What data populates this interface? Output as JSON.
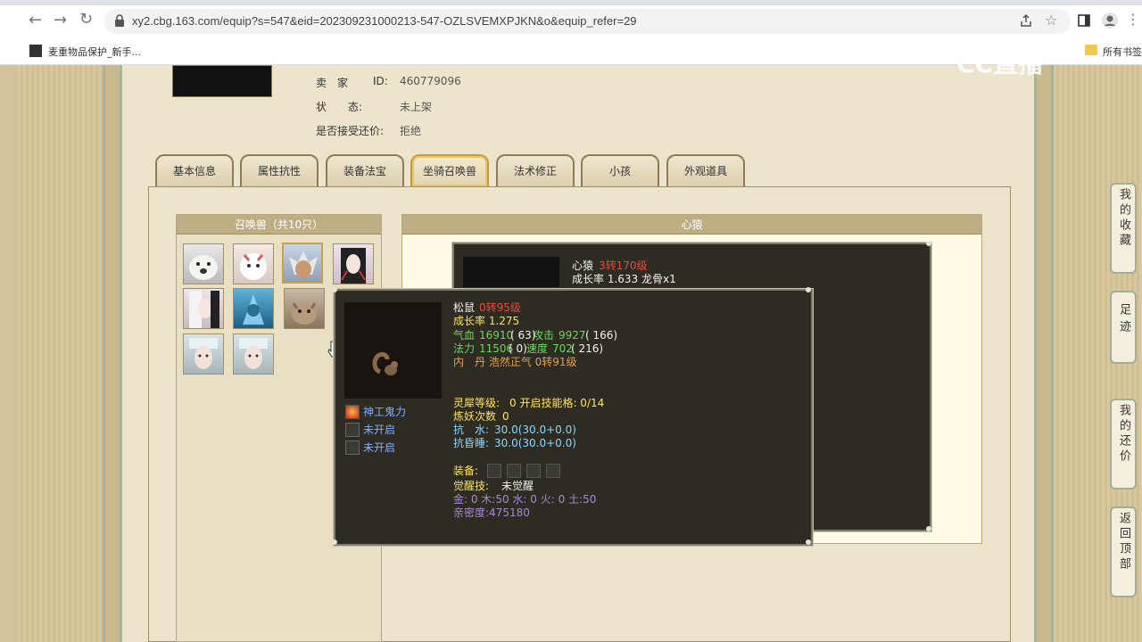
{
  "browser": {
    "url": "xy2.cbg.163.com/equip?s=547&eid=202309231000213-547-OZLSVEMXPJKN&o&equip_refer=29",
    "bookmark": "麦重物品保护_新手...",
    "all_bookmarks": "所有书签",
    "watermark": "CC直播"
  },
  "seller_info": {
    "seller_label": "卖　家",
    "seller_id_label": "ID:",
    "seller_id": "460779096",
    "status_label": "状　　态:",
    "status": "未上架",
    "counter_label": "是否接受还价:",
    "counter": "拒绝"
  },
  "tabs": [
    "基本信息",
    "属性抗性",
    "装备法宝",
    "坐骑召唤兽",
    "法术修正",
    "小孩",
    "外观道具"
  ],
  "active_tab": 3,
  "pet_list": {
    "title": "召唤兽（共10只）"
  },
  "detail": {
    "title": "心猿",
    "card": {
      "name": "心猿",
      "level": "3转170级",
      "growth": "成长率 1.633 龙骨x1"
    }
  },
  "tooltip": {
    "name": "松鼠",
    "level": "0转95级",
    "growth": "成长率 1.275",
    "hp_label": "气血",
    "hp": "16910",
    "hp_extra": "( 63)",
    "atk_label": "攻击",
    "atk": "9927",
    "atk_extra": "( 166)",
    "mp_label": "法力",
    "mp": "11506",
    "mp_extra": "( 0)",
    "spd_label": "速度",
    "spd": "702",
    "spd_extra": "( 216)",
    "inner": "内　丹 浩然正气 0转91级",
    "spirit_label": "灵犀等级:",
    "spirit": "0 开启技能格: 0/14",
    "refine_label": "炼妖次数",
    "refine": "0",
    "resist1_label": "抗　水:",
    "resist1": "30.0(30.0+0.0)",
    "resist2_label": "抗昏睡:",
    "resist2": "30.0(30.0+0.0)",
    "equip_label": "装备:",
    "awaken_label": "觉醒技:",
    "awaken": "未觉醒",
    "elements": "金: 0 木:50 水: 0 火: 0 土:50",
    "intimacy": "亲密度:475180",
    "skills": [
      "神工鬼力",
      "未开启",
      "未开启"
    ]
  },
  "side_buttons": [
    "我的收藏",
    "足迹",
    "我的还价",
    "返回顶部"
  ]
}
